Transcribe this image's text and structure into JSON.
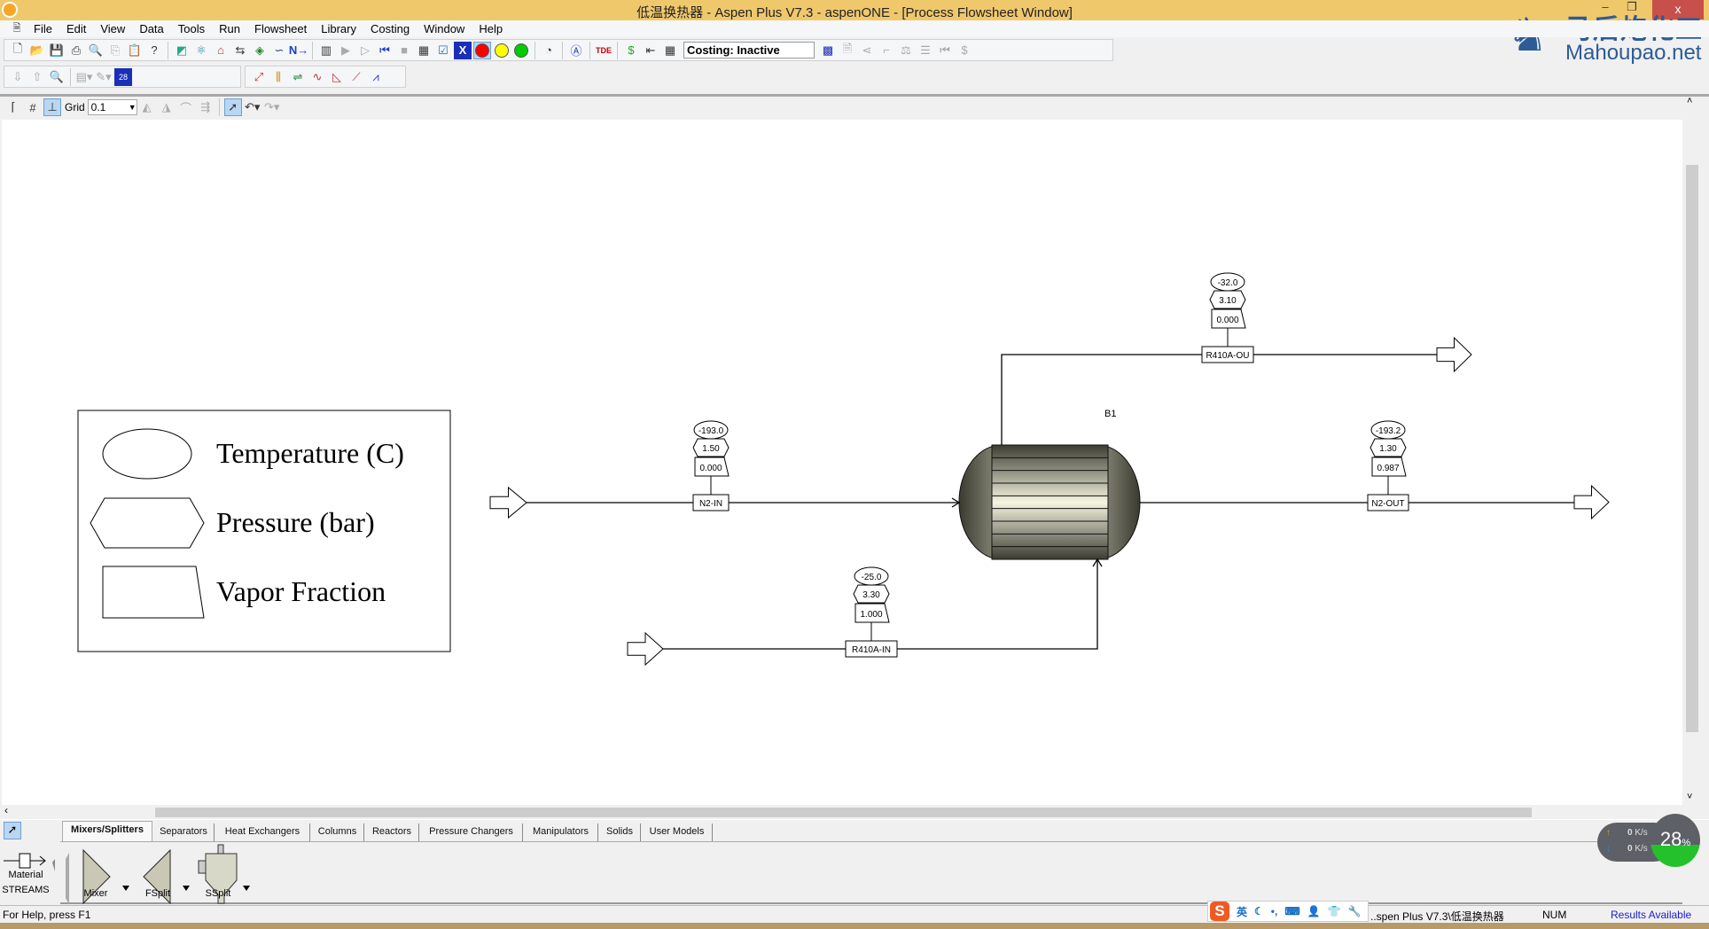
{
  "window": {
    "title": "低温换热器 - Aspen Plus V7.3 - aspenONE - [Process Flowsheet Window]",
    "close_label": "x",
    "title_bar_color": "#f0c86c"
  },
  "watermark": {
    "cn": "马后炮化工",
    "en": "Mahoupao.net"
  },
  "menu": [
    "File",
    "Edit",
    "View",
    "Data",
    "Tools",
    "Run",
    "Flowsheet",
    "Library",
    "Costing",
    "Window",
    "Help"
  ],
  "toolbar": {
    "costing_status": "Costing: Inactive",
    "status_lights": [
      "#ff0000",
      "#ffff00",
      "#00cc00"
    ]
  },
  "flowsheet_toolbar": {
    "grid_label": "Grid",
    "grid_value": "0.1"
  },
  "legend": {
    "temperature": "Temperature (C)",
    "pressure": "Pressure (bar)",
    "vapor_fraction": "Vapor Fraction"
  },
  "block": {
    "name": "B1"
  },
  "streams": [
    {
      "name": "N2-IN",
      "temperature": "-193.0",
      "pressure": "1.50",
      "vapor_fraction": "0.000"
    },
    {
      "name": "N2-OUT",
      "temperature": "-193.2",
      "pressure": "1.30",
      "vapor_fraction": "0.987"
    },
    {
      "name": "R410A-OU",
      "temperature": "-32.0",
      "pressure": "3.10",
      "vapor_fraction": "0.000"
    },
    {
      "name": "R410A-IN",
      "temperature": "-25.0",
      "pressure": "3.30",
      "vapor_fraction": "1.000"
    }
  ],
  "palette": {
    "tabs": [
      "Mixers/Splitters",
      "Separators",
      "Heat Exchangers",
      "Columns",
      "Reactors",
      "Pressure Changers",
      "Manipulators",
      "Solids",
      "User Models"
    ],
    "selected_tab": "Mixers/Splitters",
    "streams_label": "Material",
    "streams_caption": "STREAMS",
    "models": [
      "Mixer",
      "FSplit",
      "SSplit"
    ]
  },
  "statusbar": {
    "help": "For Help, press F1",
    "path": "..spen Plus V7.3\\低温换热器",
    "num": "NUM",
    "results": "Results Available",
    "ime_lang": "英"
  },
  "netmonitor": {
    "up": "0",
    "down": "0",
    "unit": "K/s",
    "cpu_percent": "28",
    "percent_sign": "%"
  }
}
